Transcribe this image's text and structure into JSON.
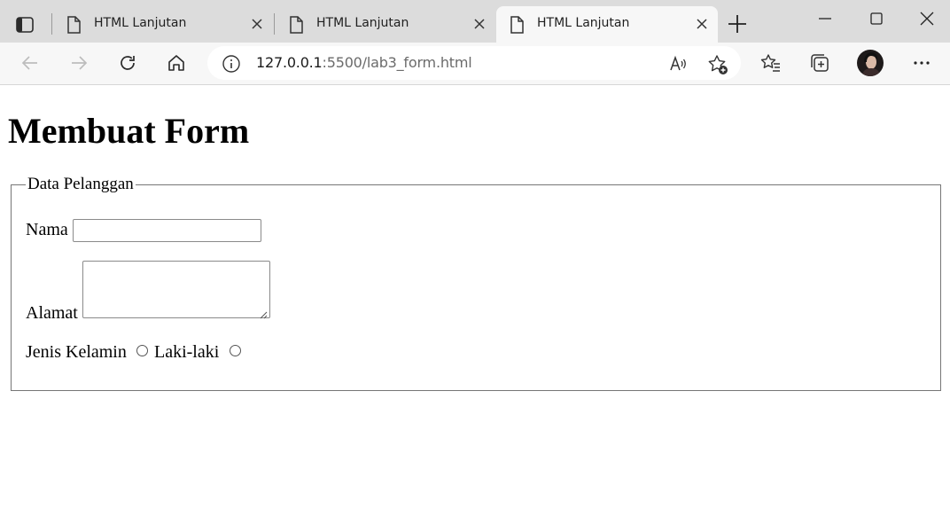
{
  "browser": {
    "tabs": [
      {
        "title": "HTML Lanjutan",
        "active": false
      },
      {
        "title": "HTML Lanjutan",
        "active": false
      },
      {
        "title": "HTML Lanjutan",
        "active": true
      }
    ],
    "url_host": "127.0.0.1",
    "url_rest": ":5500/lab3_form.html"
  },
  "page": {
    "heading": "Membuat Form",
    "fieldset_legend": "Data Pelanggan",
    "nama_label": "Nama",
    "nama_value": "",
    "alamat_label": "Alamat",
    "alamat_value": "",
    "gender_label": "Jenis Kelamin",
    "gender_option_1": "Laki-laki"
  },
  "colors": {
    "tabbar": "#dcdcdc",
    "toolbar": "#f7f7f7",
    "border": "#767676"
  }
}
